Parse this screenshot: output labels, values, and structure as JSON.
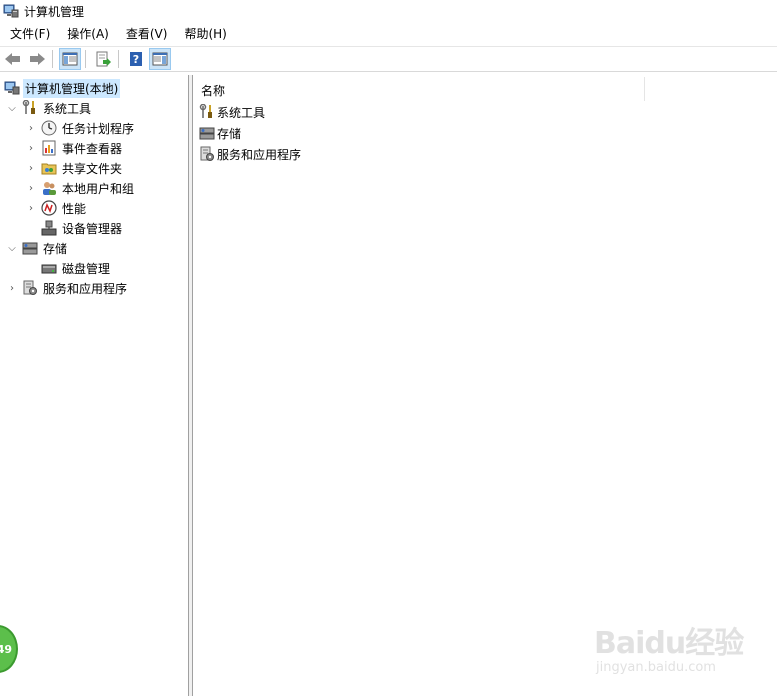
{
  "window": {
    "title": "计算机管理"
  },
  "menu": [
    "文件(F)",
    "操作(A)",
    "查看(V)",
    "帮助(H)"
  ],
  "toolbar": {
    "buttons": [
      "back-icon",
      "forward-icon",
      "show-hide-tree-icon",
      "export-list-icon",
      "help-icon",
      "show-hide-action-pane-icon"
    ]
  },
  "tree": {
    "root": "计算机管理(本地)",
    "system_tools": "系统工具",
    "task_scheduler": "任务计划程序",
    "event_viewer": "事件查看器",
    "shared_folders": "共享文件夹",
    "local_users": "本地用户和组",
    "performance": "性能",
    "device_manager": "设备管理器",
    "storage": "存储",
    "disk_management": "磁盘管理",
    "services_apps": "服务和应用程序"
  },
  "list": {
    "column_name": "名称",
    "items": [
      "系统工具",
      "存储",
      "服务和应用程序"
    ]
  },
  "overlay": {
    "badge": "49",
    "watermark_main": "Baidu经验",
    "watermark_sub": "jingyan.baidu.com"
  }
}
